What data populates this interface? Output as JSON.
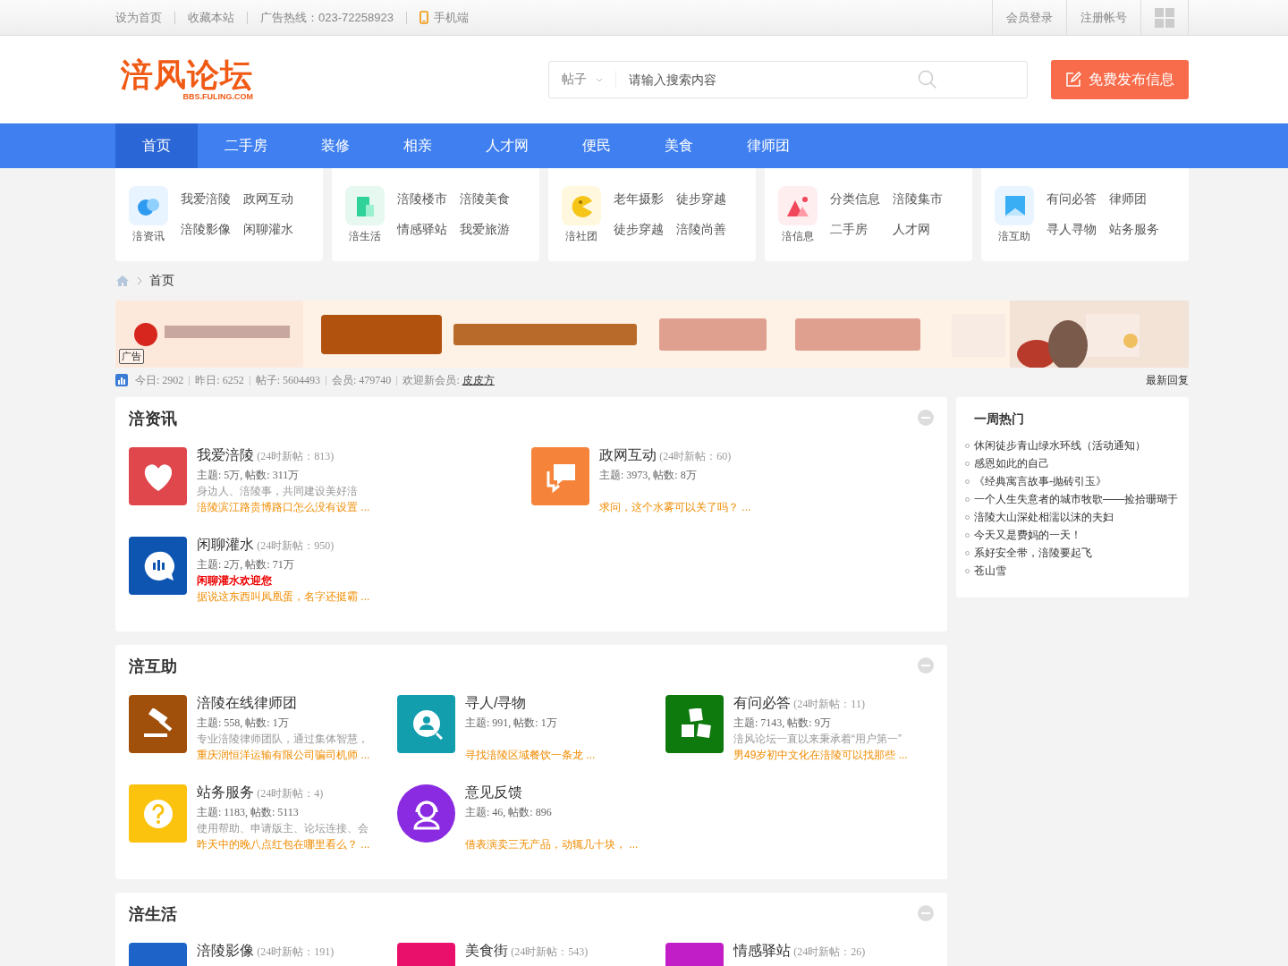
{
  "top_bar": {
    "links": [
      "设为首页",
      "收藏本站",
      "广告热线：023-72258923"
    ],
    "mobile": "手机端",
    "account": [
      "会员登录",
      "注册帐号"
    ]
  },
  "header": {
    "logo": "涪风论坛",
    "logo_sub": "BBS.FULING.COM",
    "search": {
      "scope": "帖子",
      "placeholder": "请输入搜索内容"
    },
    "post_button": "免费发布信息"
  },
  "nav": [
    {
      "label": "首页",
      "selected": true
    },
    {
      "label": "二手房",
      "selected": false
    },
    {
      "label": "装修",
      "selected": false
    },
    {
      "label": "相亲",
      "selected": false
    },
    {
      "label": "人才网",
      "selected": false
    },
    {
      "label": "便民",
      "selected": false
    },
    {
      "label": "美食",
      "selected": false
    },
    {
      "label": "律师团",
      "selected": false
    }
  ],
  "quick_nav": [
    {
      "label": "涪资讯",
      "color": "#2e9bf0",
      "links": [
        "我爱涪陵",
        "政网互动",
        "涪陵影像",
        "闲聊灌水"
      ]
    },
    {
      "label": "涪生活",
      "color": "#2fd39a",
      "links": [
        "涪陵楼市",
        "涪陵美食",
        "情感驿站",
        "我爱旅游"
      ]
    },
    {
      "label": "涪社团",
      "color": "#f5c518",
      "links": [
        "老年摄影",
        "徒步穿越",
        "徒步穿越",
        "涪陵尚善"
      ]
    },
    {
      "label": "涪信息",
      "color": "#f0485a",
      "links": [
        "分类信息",
        "涪陵集市",
        "二手房",
        "人才网"
      ]
    },
    {
      "label": "涪互助",
      "color": "#3aaef5",
      "links": [
        "有问必答",
        "律师团",
        "寻人寻物",
        "站务服务"
      ]
    }
  ],
  "breadcrumb": [
    "首页"
  ],
  "banner": {
    "kind": "picture",
    "tag": "广告"
  },
  "stats": {
    "items": [
      "今日: 2902",
      "昨日: 6252",
      "帖子: 5604493",
      "会员: 479740"
    ],
    "welcome": "欢迎新会员:",
    "new_member": "皮皮方",
    "latest": "最新回复"
  },
  "sections": [
    {
      "title": "涪资讯",
      "forums": [
        {
          "name": "我爱涪陵",
          "count": "(24时新帖：813)",
          "color": "#e0474c",
          "stats": "主题: 5万, 帖数: 311万",
          "desc": "身边人、涪陵事，共同建设美好涪",
          "last": "涪陵滨江路贵博路口怎么没有设置 ..."
        },
        {
          "name": "政网互动",
          "count": "(24时新帖：60)",
          "color": "#f5843a",
          "stats": "主题: 3973, 帖数: 8万",
          "last": "求问，这个水雾可以关了吗？ ..."
        },
        {
          "name": "闲聊灌水",
          "count": "(24时新帖：950)",
          "color": "#0d55b0",
          "stats": "主题: 2万, 帖数: 71万",
          "notice": "闲聊灌水欢迎您",
          "last": "据说这东西叫凤凰蛋，名字还挺霸 ..."
        }
      ]
    },
    {
      "title": "涪互助",
      "forums": [
        {
          "name": "涪陵在线律师团",
          "color": "#a0500a",
          "stats": "主题: 558, 帖数: 1万",
          "desc": "专业涪陵律师团队，通过集体智慧，",
          "last": "重庆润恒洋运输有限公司骗司机师 ..."
        },
        {
          "name": "寻人/寻物",
          "color": "#139eae",
          "stats": "主题: 991, 帖数: 1万",
          "last": "寻找涪陵区域餐饮一条龙 ..."
        },
        {
          "name": "有问必答",
          "count": "(24时新帖：11)",
          "color": "#0e7a0e",
          "stats": "主题: 7143, 帖数: 9万",
          "desc": "涪风论坛一直以来秉承着“用户第一”",
          "last": "男49岁初中文化在涪陵可以找那些 ..."
        },
        {
          "name": "站务服务",
          "count": "(24时新帖：4)",
          "color": "#fbc20e",
          "stats": "主题: 1183, 帖数: 5113",
          "desc": "使用帮助、申请版主、论坛连接、会",
          "last": "昨天中的晚八点红包在哪里看么？ ..."
        },
        {
          "name": "意见反馈",
          "color": "#8a2be2",
          "stats": "主题: 46, 帖数: 896",
          "last": "借表演卖三无产品，动辄几十块， ..."
        }
      ]
    },
    {
      "title": "涪生活",
      "forums": [
        {
          "name": "涪陵影像",
          "count": "(24时新帖：191)",
          "color": "#1e63c8"
        },
        {
          "name": "美食街",
          "count": "(24时新帖：543)",
          "color": "#e8106a"
        },
        {
          "name": "情感驿站",
          "count": "(24时新帖：26)",
          "color": "#c21ec8"
        }
      ]
    }
  ],
  "hot": {
    "title": "一周热门",
    "items": [
      "休闲徒步青山绿水环线（活动通知）",
      "感恩如此的自己",
      "《经典寓言故事-抛砖引玉》",
      "一个人生失意者的城市牧歌——捡拾珊瑚于",
      "涪陵大山深处相濡以沫的夫妇",
      "今天又是费妈的一天！",
      "系好安全带，涪陵要起飞",
      "苍山雪"
    ]
  }
}
